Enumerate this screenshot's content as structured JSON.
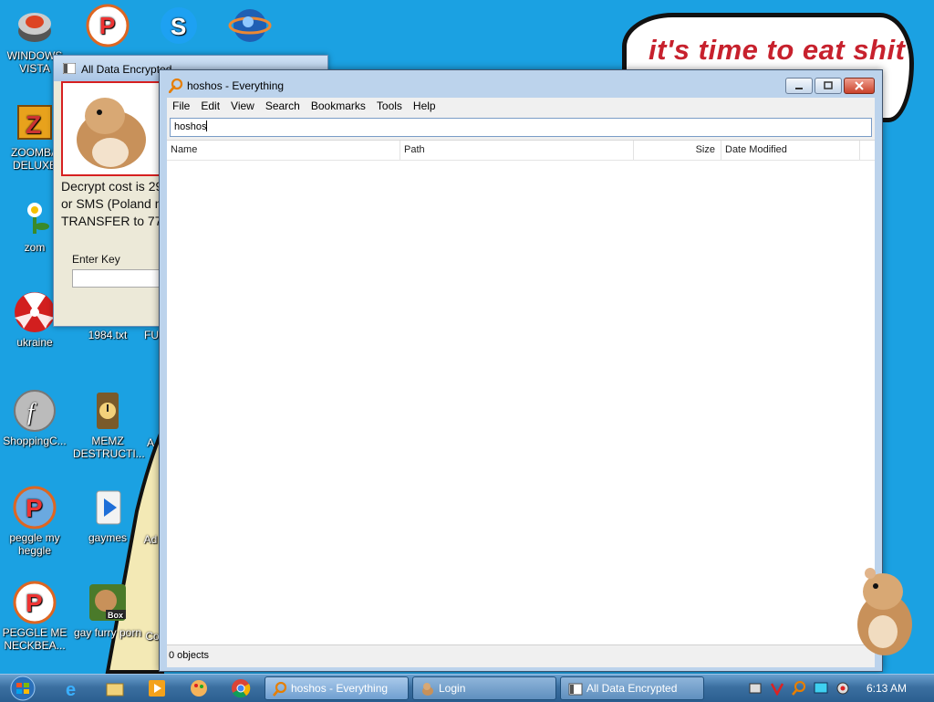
{
  "wallpaper": {
    "speech_text": "it's time to eat shit"
  },
  "desktop_icons": [
    {
      "label": "WINDOWS VISTA",
      "icon": "pinball-icon"
    },
    {
      "label": "ZOOMBA DELUXE",
      "icon": "zuma-icon"
    },
    {
      "label": "zom",
      "icon": "plant-icon"
    },
    {
      "label": "ukraine",
      "icon": "radiation-icon"
    },
    {
      "label": "1984.txt",
      "icon": "text-file-icon"
    },
    {
      "label": "FU",
      "icon": "file-icon"
    },
    {
      "label": "ShoppingC...",
      "icon": "flash-icon"
    },
    {
      "label": "MEMZ DESTRUCTI...",
      "icon": "memz-icon"
    },
    {
      "label": "A",
      "icon": "file-icon"
    },
    {
      "label": "peggle my heggle",
      "icon": "peggle-icon"
    },
    {
      "label": "gaymes",
      "icon": "games-folder-icon"
    },
    {
      "label": "Ad",
      "icon": "file-icon"
    },
    {
      "label": "PEGGLE ME NECKBEA...",
      "icon": "peggle-icon"
    },
    {
      "label": "gay furry porn",
      "icon": "box-icon"
    },
    {
      "label": "Co",
      "icon": "file-icon"
    }
  ],
  "top_icons": [
    {
      "name": "pinball-icon"
    },
    {
      "name": "peggle-icon"
    },
    {
      "name": "skype-icon"
    },
    {
      "name": "ie-globe-icon"
    }
  ],
  "ransom_window": {
    "title": "All Data Encrypted",
    "text_lines": [
      "Decrypt cost is 29",
      "or SMS (Poland n",
      "TRANSFER to 770"
    ],
    "enter_key_label": "Enter Key"
  },
  "everything_window": {
    "title": "hoshos - Everything",
    "menu": [
      "File",
      "Edit",
      "View",
      "Search",
      "Bookmarks",
      "Tools",
      "Help"
    ],
    "search_value": "hoshos",
    "columns": [
      "Name",
      "Path",
      "Size",
      "Date Modified"
    ],
    "status": "0 objects"
  },
  "taskbar": {
    "pinned": [
      "ie-icon",
      "explorer-icon",
      "media-player-icon",
      "paint-icon",
      "chrome-icon"
    ],
    "buttons": [
      {
        "label": "hoshos - Everything",
        "icon": "everything-icon",
        "active": true
      },
      {
        "label": "Login",
        "icon": "hamster-icon",
        "active": false
      },
      {
        "label": "All Data Encrypted",
        "icon": "window-icon",
        "active": false
      }
    ],
    "clock": "6:13 AM"
  },
  "colors": {
    "desktop_bg": "#1ba1e2",
    "speech_text": "#c7212d",
    "sand": "#f3e9b5"
  }
}
